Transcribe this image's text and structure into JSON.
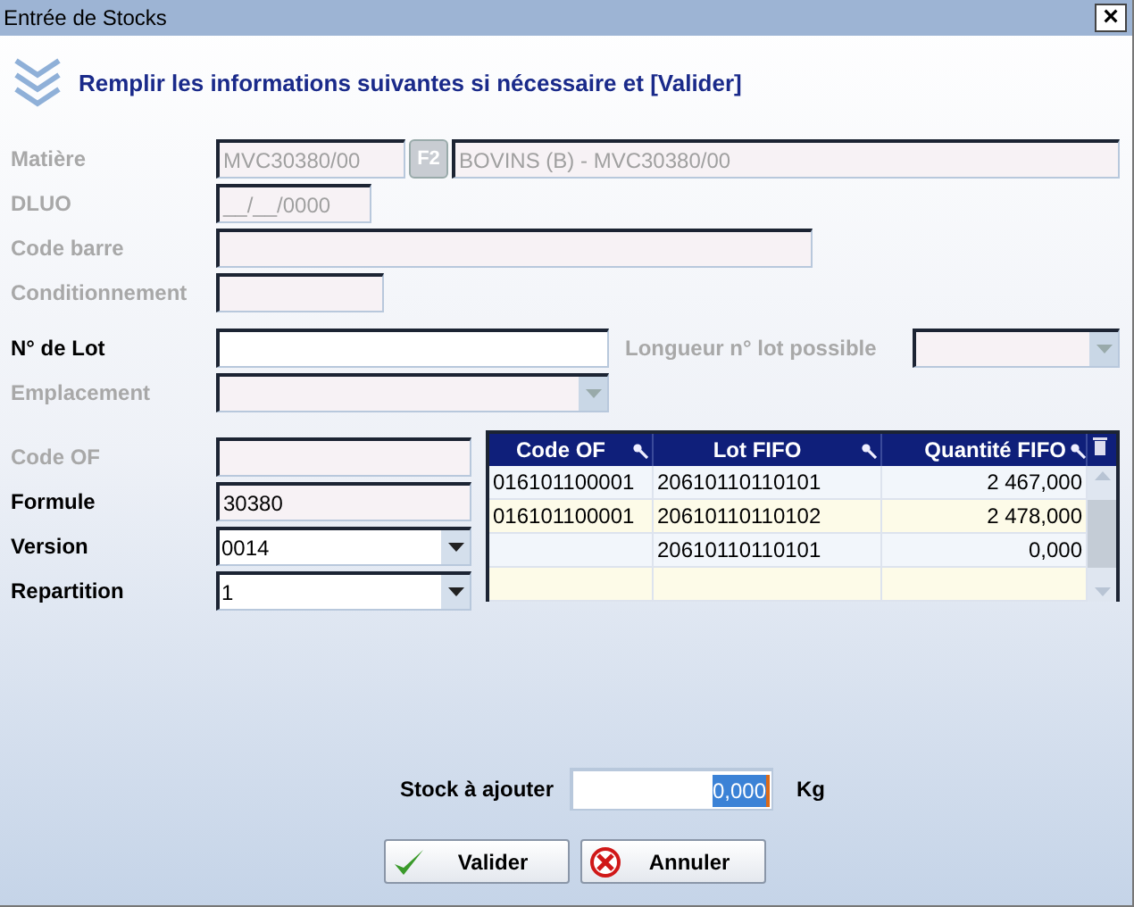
{
  "window": {
    "title": "Entrée de Stocks",
    "close": "×"
  },
  "instruction": "Remplir les informations suivantes si nécessaire et [Valider]",
  "fields_top": [
    {
      "label": "Matière",
      "kind": "lookup",
      "enabled": false,
      "value": "MVC30380/00",
      "key": "F2",
      "description": "BOVINS (B) - MVC30380/00"
    },
    {
      "label": "DLUO",
      "kind": "date",
      "enabled": false,
      "value": "__/__/0000"
    },
    {
      "label": "Code barre",
      "kind": "wide",
      "enabled": false
    },
    {
      "label": "Conditionnement",
      "kind": "short",
      "enabled": false
    }
  ],
  "lot": {
    "label": "N° de Lot",
    "enabled": true,
    "length_label": "Longueur n° lot possible",
    "length_enabled": false
  },
  "emplacement": {
    "label": "Emplacement",
    "enabled": false
  },
  "fields_left": [
    {
      "label": "Code OF",
      "kind": "text",
      "enabled": false
    },
    {
      "label": "Formule",
      "kind": "text",
      "enabled": false,
      "strong": true,
      "value": "30380"
    },
    {
      "label": "Version",
      "kind": "combo",
      "enabled": true,
      "value": "0014"
    },
    {
      "label": "Repartition",
      "kind": "combo",
      "enabled": true,
      "value": "1"
    }
  ],
  "fifo_table": {
    "columns": [
      "Code OF",
      "Lot FIFO",
      "Quantité FIFO"
    ],
    "rows": [
      [
        "016101100001",
        "20610110110101",
        "2 467,000"
      ],
      [
        "016101100001",
        "20610110110102",
        "2 478,000"
      ],
      [
        "",
        "20610110110101",
        "0,000"
      ]
    ]
  },
  "stock": {
    "label": "Stock à ajouter",
    "value": "0,000",
    "unit": "Kg"
  },
  "buttons": [
    {
      "label": "Valider",
      "kind": "ok"
    },
    {
      "label": "Annuler",
      "kind": "cancel"
    }
  ]
}
